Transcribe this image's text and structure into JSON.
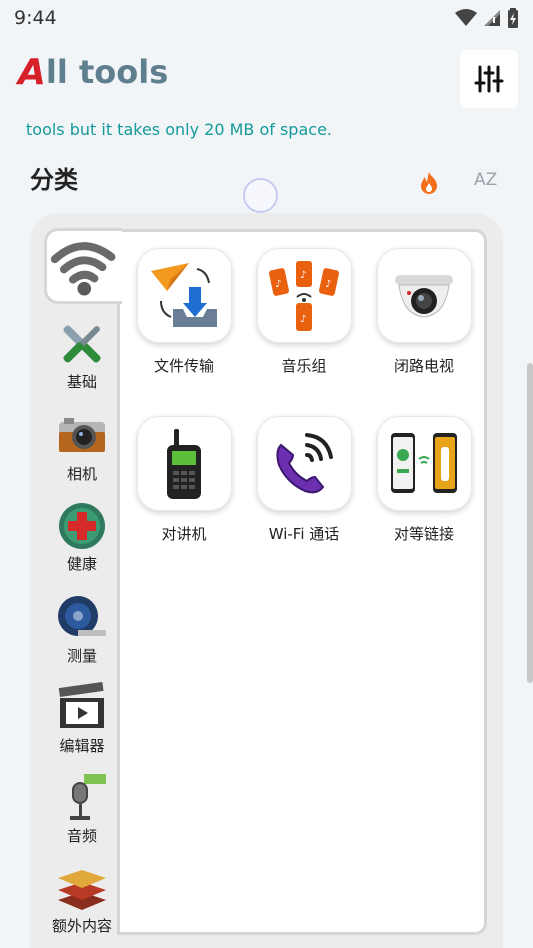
{
  "status": {
    "time": "9:44"
  },
  "header": {
    "logo_a": "A",
    "logo_rest": "ll tools",
    "settings_icon": "sliders-icon",
    "tagline": "tools but it takes only 20 MB of space."
  },
  "section": {
    "title": "分类",
    "sort_hot_icon": "fire-icon",
    "sort_az_label": "AZ"
  },
  "categories": [
    {
      "label": "",
      "icon": "wifi-icon",
      "selected": true
    },
    {
      "label": "基础",
      "icon": "tools-icon"
    },
    {
      "label": "相机",
      "icon": "camera-icon"
    },
    {
      "label": "健康",
      "icon": "health-icon"
    },
    {
      "label": "测量",
      "icon": "tape-measure-icon"
    },
    {
      "label": "编辑器",
      "icon": "clapperboard-icon"
    },
    {
      "label": "音频",
      "icon": "microphone-icon"
    },
    {
      "label": "额外内容",
      "icon": "stack-icon"
    }
  ],
  "tools": [
    {
      "label": "文件传输",
      "icon": "file-transfer-icon"
    },
    {
      "label": "音乐组",
      "icon": "music-group-icon"
    },
    {
      "label": "闭路电视",
      "icon": "cctv-icon"
    },
    {
      "label": "对讲机",
      "icon": "walkie-talkie-icon"
    },
    {
      "label": "Wi-Fi 通话",
      "icon": "wifi-call-icon"
    },
    {
      "label": "对等链接",
      "icon": "peer-link-icon"
    }
  ],
  "colors": {
    "accent_red": "#d6202a",
    "logo_grey": "#5f7f8f",
    "tagline_teal": "#159a9a",
    "hot_orange": "#f36f1c"
  }
}
